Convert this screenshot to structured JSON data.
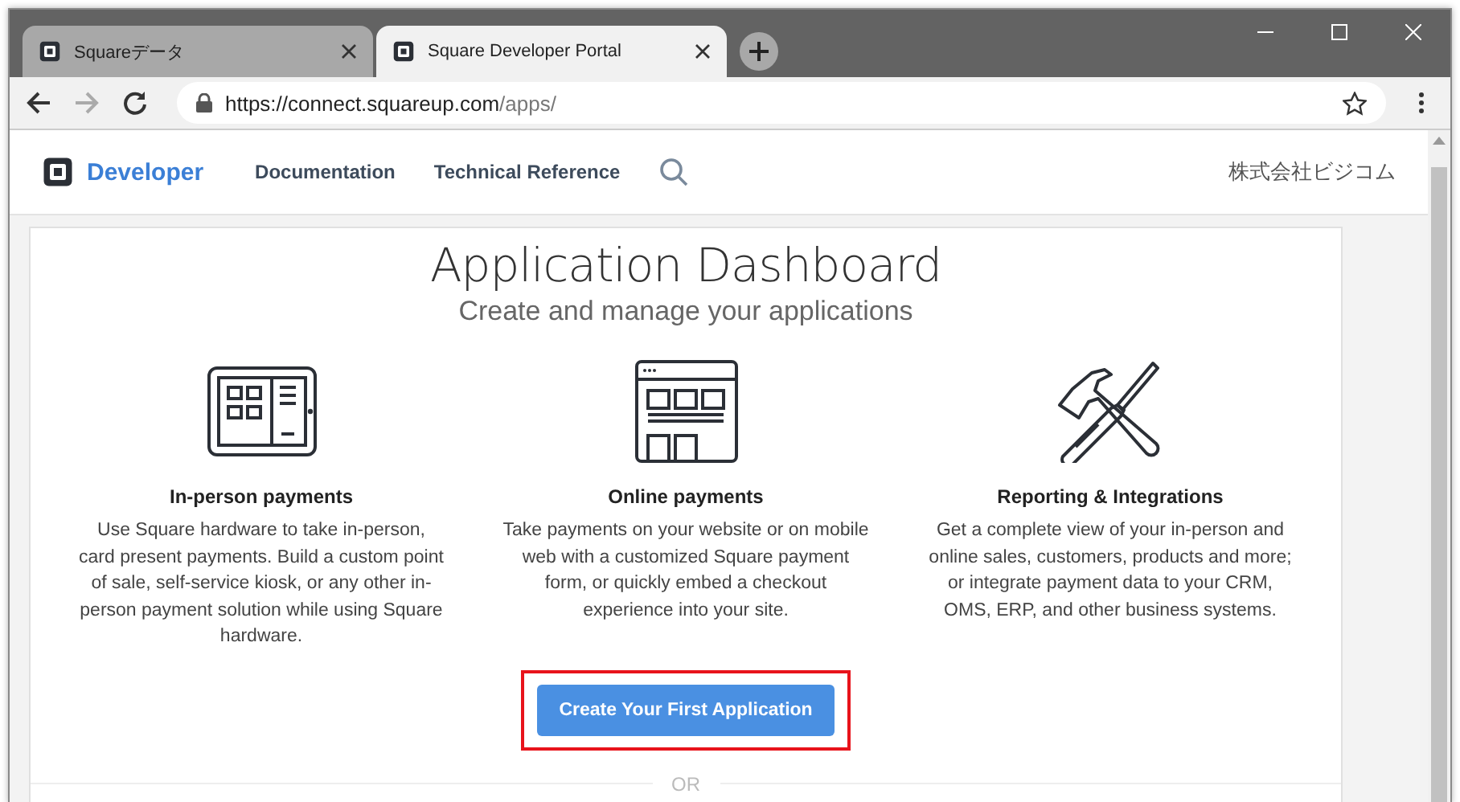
{
  "browser": {
    "tabs": [
      {
        "title": "Squareデータ",
        "selected": false
      },
      {
        "title": "Square Developer Portal",
        "selected": true
      }
    ],
    "url_host": "https://connect.squareup.com",
    "url_path": "/apps/"
  },
  "site_nav": {
    "brand": "Developer",
    "links": [
      "Documentation",
      "Technical Reference"
    ],
    "account": "株式会社ビジコム"
  },
  "dashboard": {
    "title": "Application Dashboard",
    "subtitle": "Create and manage your applications",
    "features": [
      {
        "kind": "terminal",
        "heading": "In-person payments",
        "text": "Use Square hardware to take in-person, card present payments. Build a custom point of sale, self-service kiosk, or any other in-person payment solution while using Square hardware."
      },
      {
        "kind": "web",
        "heading": "Online payments",
        "text": "Take payments on your website or on mobile web with a customized Square payment form, or quickly embed a checkout experience into your site."
      },
      {
        "kind": "tools",
        "heading": "Reporting & Integrations",
        "text": "Get a complete view of your in-person and online sales, customers, products and more; or integrate payment data to your CRM, OMS, ERP, and other business systems."
      }
    ],
    "create_button": {
      "label": "Create Your First Application",
      "highlighted": true
    },
    "divider_text": "OR"
  }
}
